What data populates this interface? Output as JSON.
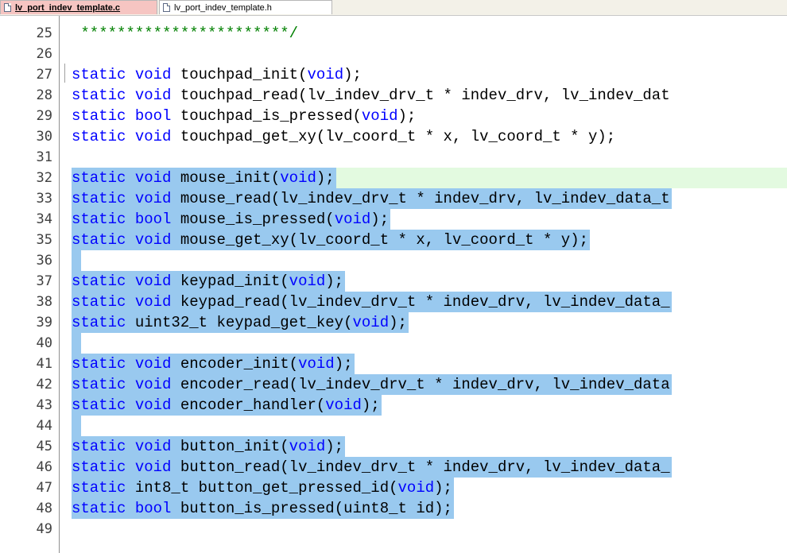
{
  "tabs": [
    {
      "label": "lv_port_indev_template.c",
      "active": true
    },
    {
      "label": "lv_port_indev_template.h",
      "active": false
    }
  ],
  "lines": [
    {
      "num": "25",
      "text": " ***********************/",
      "type": "comment",
      "selected": false
    },
    {
      "num": "26",
      "text": "",
      "type": "plain",
      "selected": false
    },
    {
      "num": "27",
      "text": "static void touchpad_init(void);",
      "type": "code",
      "selected": false
    },
    {
      "num": "28",
      "text": "static void touchpad_read(lv_indev_drv_t * indev_drv, lv_indev_dat",
      "type": "code",
      "selected": false
    },
    {
      "num": "29",
      "text": "static bool touchpad_is_pressed(void);",
      "type": "code",
      "selected": false
    },
    {
      "num": "30",
      "text": "static void touchpad_get_xy(lv_coord_t * x, lv_coord_t * y);",
      "type": "code",
      "selected": false
    },
    {
      "num": "31",
      "text": "",
      "type": "plain",
      "selected": false
    },
    {
      "num": "32",
      "text": "static void mouse_init(void);",
      "type": "code",
      "selected": true,
      "caret": true
    },
    {
      "num": "33",
      "text": "static void mouse_read(lv_indev_drv_t * indev_drv, lv_indev_data_t",
      "type": "code",
      "selected": true
    },
    {
      "num": "34",
      "text": "static bool mouse_is_pressed(void);",
      "type": "code",
      "selected": true
    },
    {
      "num": "35",
      "text": "static void mouse_get_xy(lv_coord_t * x, lv_coord_t * y);",
      "type": "code",
      "selected": true
    },
    {
      "num": "36",
      "text": "",
      "type": "plain",
      "selected": true
    },
    {
      "num": "37",
      "text": "static void keypad_init(void);",
      "type": "code",
      "selected": true
    },
    {
      "num": "38",
      "text": "static void keypad_read(lv_indev_drv_t * indev_drv, lv_indev_data_",
      "type": "code",
      "selected": true
    },
    {
      "num": "39",
      "text": "static uint32_t keypad_get_key(void);",
      "type": "code",
      "selected": true
    },
    {
      "num": "40",
      "text": "",
      "type": "plain",
      "selected": true
    },
    {
      "num": "41",
      "text": "static void encoder_init(void);",
      "type": "code",
      "selected": true
    },
    {
      "num": "42",
      "text": "static void encoder_read(lv_indev_drv_t * indev_drv, lv_indev_data",
      "type": "code",
      "selected": true
    },
    {
      "num": "43",
      "text": "static void encoder_handler(void);",
      "type": "code",
      "selected": true
    },
    {
      "num": "44",
      "text": "",
      "type": "plain",
      "selected": true
    },
    {
      "num": "45",
      "text": "static void button_init(void);",
      "type": "code",
      "selected": true
    },
    {
      "num": "46",
      "text": "static void button_read(lv_indev_drv_t * indev_drv, lv_indev_data_",
      "type": "code",
      "selected": true
    },
    {
      "num": "47",
      "text": "static int8_t button_get_pressed_id(void);",
      "type": "code",
      "selected": true
    },
    {
      "num": "48",
      "text": "static bool button_is_pressed(uint8_t id);",
      "type": "code",
      "selected": true
    },
    {
      "num": "49",
      "text": "",
      "type": "plain",
      "selected": false
    }
  ],
  "keywords": [
    "static",
    "void",
    "bool"
  ],
  "colors": {
    "keyword": "#0000ff",
    "comment": "#008000",
    "selection": "#99c9ef",
    "caret_line": "#e3fae0",
    "active_tab": "#f6c5c2"
  }
}
